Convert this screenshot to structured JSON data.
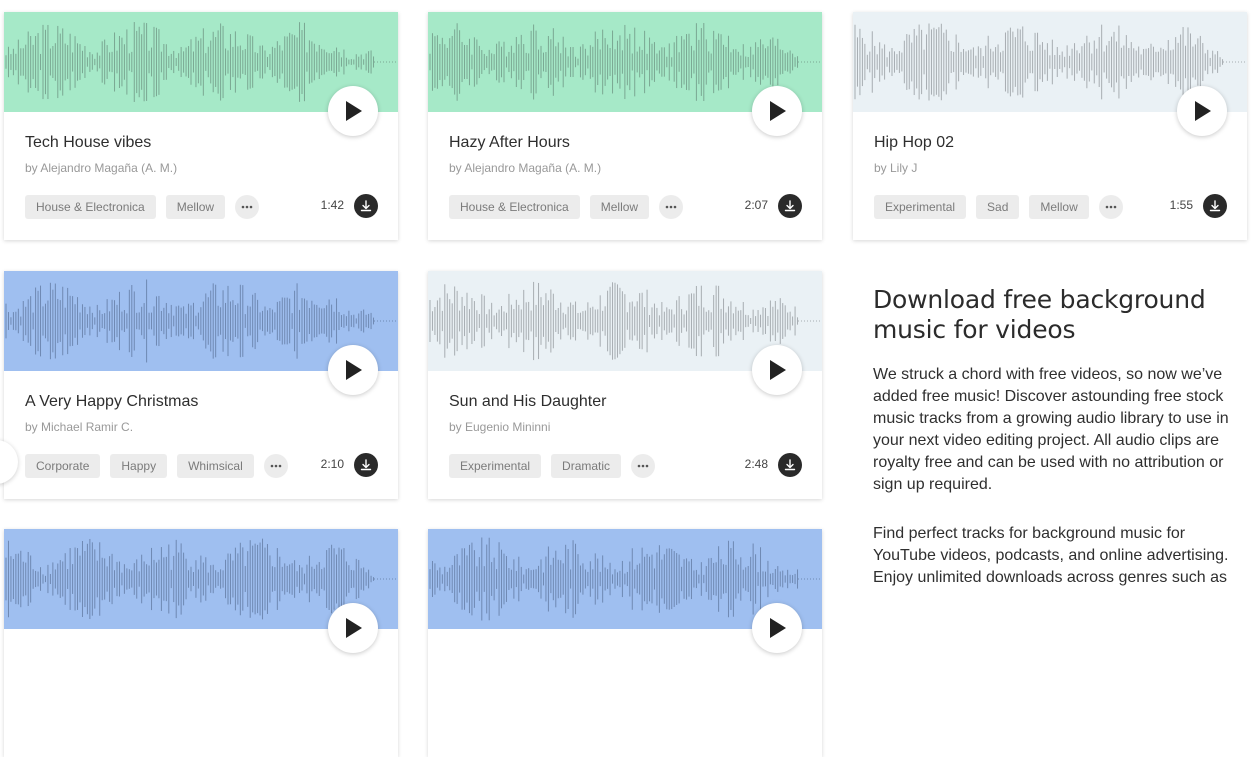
{
  "tracks": [
    {
      "title": "Tech House vibes",
      "author": "by Alejandro Magaña (A. M.)",
      "tags": [
        "House & Electronica",
        "Mellow"
      ],
      "duration": "1:42",
      "wave_bg": "#a6e9c8",
      "bar_color": "#7aa792"
    },
    {
      "title": "Hazy After Hours",
      "author": "by Alejandro Magaña (A. M.)",
      "tags": [
        "House & Electronica",
        "Mellow"
      ],
      "duration": "2:07",
      "wave_bg": "#a6e9c8",
      "bar_color": "#7aa792"
    },
    {
      "title": "Hip Hop 02",
      "author": "by Lily J",
      "tags": [
        "Experimental",
        "Sad",
        "Mellow"
      ],
      "duration": "1:55",
      "wave_bg": "#eaf1f5",
      "bar_color": "#a7adb1"
    },
    {
      "title": "A Very Happy Christmas",
      "author": "by Michael Ramir C.",
      "tags": [
        "Corporate",
        "Happy",
        "Whimsical"
      ],
      "duration": "2:10",
      "wave_bg": "#9fbff0",
      "bar_color": "#6e88b2"
    },
    {
      "title": "Sun and His Daughter",
      "author": "by Eugenio Mininni",
      "tags": [
        "Experimental",
        "Dramatic"
      ],
      "duration": "2:48",
      "wave_bg": "#eaf1f5",
      "bar_color": "#a7adb1"
    },
    {
      "title": "",
      "author": "",
      "tags": [],
      "duration": "",
      "wave_bg": "#9fbff0",
      "bar_color": "#6e88b2"
    },
    {
      "title": "",
      "author": "",
      "tags": [],
      "duration": "",
      "wave_bg": "#9fbff0",
      "bar_color": "#6e88b2"
    }
  ],
  "info": {
    "heading": "Download free background music for videos",
    "paragraph1": "We struck a chord with free videos, so now we’ve added free music! Discover astounding free stock music tracks from a growing audio library to use in your next video editing project. All audio clips are royalty free and can be used with no attribution or sign up required.",
    "paragraph2": "Find perfect tracks for background music for YouTube videos, podcasts, and online advertising. Enjoy unlimited downloads across genres such as"
  },
  "icons": {
    "play": "play-icon",
    "more": "more-icon",
    "download": "download-icon"
  }
}
